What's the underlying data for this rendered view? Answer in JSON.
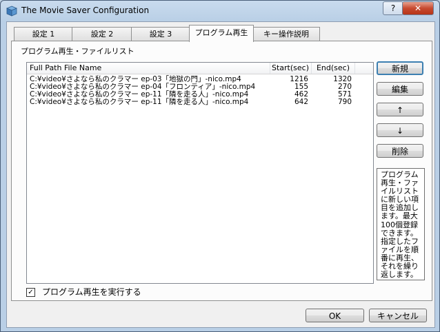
{
  "window": {
    "title": "The Movie Saver Configuration",
    "help_glyph": "?",
    "close_glyph": "✕"
  },
  "tabs": [
    {
      "label": "設定 1"
    },
    {
      "label": "設定 2"
    },
    {
      "label": "設定 3"
    },
    {
      "label": "プログラム再生",
      "active": true
    },
    {
      "label": "キー操作説明"
    }
  ],
  "section_label": "プログラム再生・ファイルリスト",
  "list": {
    "columns": [
      "Full Path File Name",
      "Start(sec)",
      "End(sec)"
    ],
    "rows": [
      {
        "path": "C:¥video¥さよなら私のクラマー ep-03「地獄の門」-nico.mp4",
        "start": "1216",
        "end": "1320"
      },
      {
        "path": "C:¥video¥さよなら私のクラマー ep-04「フロンティア」-nico.mp4",
        "start": "155",
        "end": "270"
      },
      {
        "path": "C:¥video¥さよなら私のクラマー ep-11「隣を走る人」-nico.mp4",
        "start": "462",
        "end": "571"
      },
      {
        "path": "C:¥video¥さよなら私のクラマー ep-11「隣を走る人」-nico.mp4",
        "start": "642",
        "end": "790"
      }
    ]
  },
  "buttons": {
    "new": "新規",
    "edit": "編集",
    "up": "↑",
    "down": "↓",
    "delete": "削除",
    "ok": "OK",
    "cancel": "キャンセル"
  },
  "help_lines": [
    "プログラム",
    "再生・ファ",
    "イルリスト",
    "に新しい項",
    "目を追加し",
    "ます。最大",
    "100個登録",
    "できます。",
    "指定したフ",
    "ァイルを順",
    "番に再生、",
    "それを繰り",
    "返します。"
  ],
  "checkbox": {
    "label": "プログラム再生を実行する",
    "checked": true,
    "glyph": "✓"
  }
}
